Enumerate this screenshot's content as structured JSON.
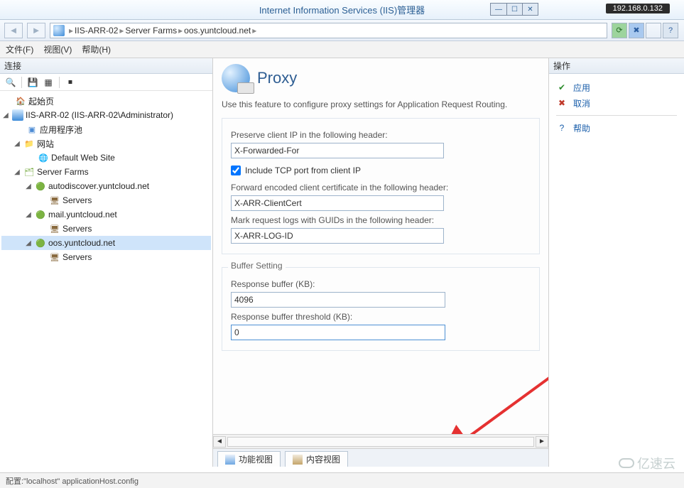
{
  "titlebar": {
    "title": "Internet Information Services (IIS)管理器",
    "ip": "192.168.0.132"
  },
  "breadcrumb": {
    "items": [
      "IIS-ARR-02",
      "Server Farms",
      "oos.yuntcloud.net"
    ]
  },
  "menubar": {
    "file": "文件(F)",
    "view": "视图(V)",
    "help": "帮助(H)"
  },
  "leftPanel": {
    "title": "连接"
  },
  "tree": {
    "start": "起始页",
    "server": "IIS-ARR-02 (IIS-ARR-02\\Administrator)",
    "apppools": "应用程序池",
    "sites": "网站",
    "defaultSite": "Default Web Site",
    "serverFarms": "Server Farms",
    "farm1": "autodiscover.yuntcloud.net",
    "farm2": "mail.yuntcloud.net",
    "farm3": "oos.yuntcloud.net",
    "servers": "Servers"
  },
  "proxy": {
    "title": "Proxy",
    "desc": "Use this feature to configure proxy settings for Application Request Routing.",
    "preserveLabel": "Preserve client IP in the following header:",
    "preserveValue": "X-Forwarded-For",
    "includeTcp": "Include TCP port from client IP",
    "forwardCertLabel": "Forward encoded client certificate in the following header:",
    "forwardCertValue": "X-ARR-ClientCert",
    "markLogsLabel": "Mark request logs with GUIDs in the following header:",
    "markLogsValue": "X-ARR-LOG-ID",
    "bufferGroup": "Buffer Setting",
    "respBufferLabel": "Response buffer (KB):",
    "respBufferValue": "4096",
    "respThresholdLabel": "Response buffer threshold (KB):",
    "respThresholdValue": "0"
  },
  "viewTabs": {
    "features": "功能视图",
    "content": "内容视图"
  },
  "rightPanel": {
    "title": "操作",
    "apply": "应用",
    "cancel": "取消",
    "help": "帮助"
  },
  "status": {
    "text": "配置:\"localhost\" applicationHost.config"
  },
  "watermark": "亿速云"
}
